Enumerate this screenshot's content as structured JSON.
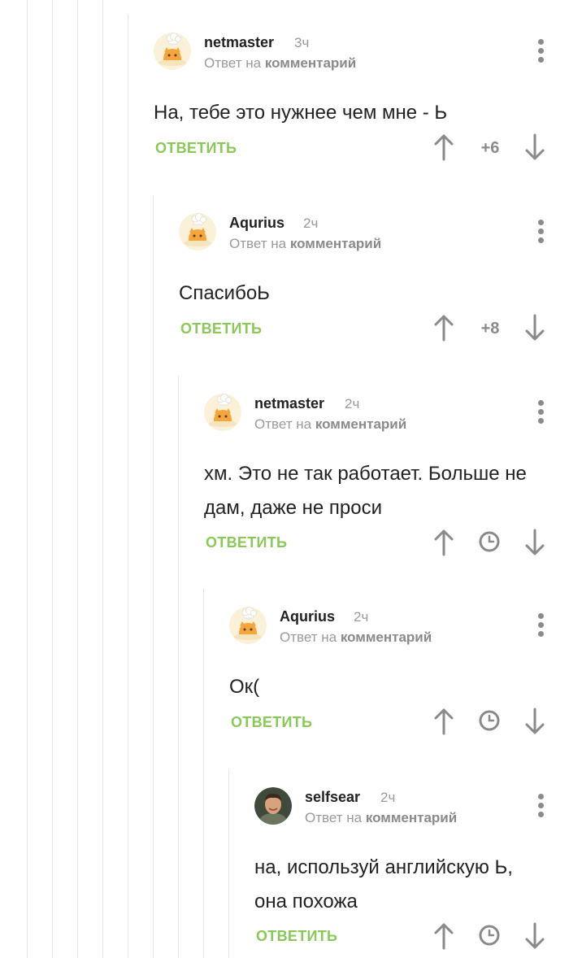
{
  "colors": {
    "accent_green": "#8ac858",
    "muted_gray": "#9a9a9a",
    "icon_gray": "#8a8a8a",
    "thread_line": "#e6e6e6"
  },
  "comments": [
    {
      "author": "netmaster",
      "time": "3ч",
      "reply_prefix": "Ответ на",
      "reply_target": "комментарий",
      "text": "На, тебе это нужнее чем мне - Ь",
      "reply_label": "ОТВЕТИТЬ",
      "rating": "+6",
      "avatar": "chef-cat-avatar",
      "icons": [
        "upvote-arrow-icon",
        "downvote-arrow-icon",
        "more-dots-icon"
      ]
    },
    {
      "author": "Aqurius",
      "time": "2ч",
      "reply_prefix": "Ответ на",
      "reply_target": "комментарий",
      "text": "СпасибоЬ",
      "reply_label": "ОТВЕТИТЬ",
      "rating": "+8",
      "avatar": "chef-cat-avatar",
      "icons": [
        "upvote-arrow-icon",
        "downvote-arrow-icon",
        "more-dots-icon"
      ]
    },
    {
      "author": "netmaster",
      "time": "2ч",
      "reply_prefix": "Ответ на",
      "reply_target": "комментарий",
      "text": "хм. Это не так работает. Больше не дам, даже не проси",
      "reply_label": "ОТВЕТИТЬ",
      "avatar": "chef-cat-avatar",
      "icons": [
        "upvote-arrow-icon",
        "clock-icon",
        "downvote-arrow-icon",
        "more-dots-icon"
      ]
    },
    {
      "author": "Aqurius",
      "time": "2ч",
      "reply_prefix": "Ответ на",
      "reply_target": "комментарий",
      "text": "Ок(",
      "reply_label": "ОТВЕТИТЬ",
      "avatar": "chef-cat-avatar",
      "icons": [
        "upvote-arrow-icon",
        "clock-icon",
        "downvote-arrow-icon",
        "more-dots-icon"
      ]
    },
    {
      "author": "selfsear",
      "time": "2ч",
      "reply_prefix": "Ответ на",
      "reply_target": "комментарий",
      "text": "на, используй английскую Ь, она похожа",
      "reply_label": "ОТВЕТИТЬ",
      "avatar": "user-photo-avatar",
      "icons": [
        "upvote-arrow-icon",
        "clock-icon",
        "downvote-arrow-icon",
        "more-dots-icon"
      ]
    }
  ]
}
